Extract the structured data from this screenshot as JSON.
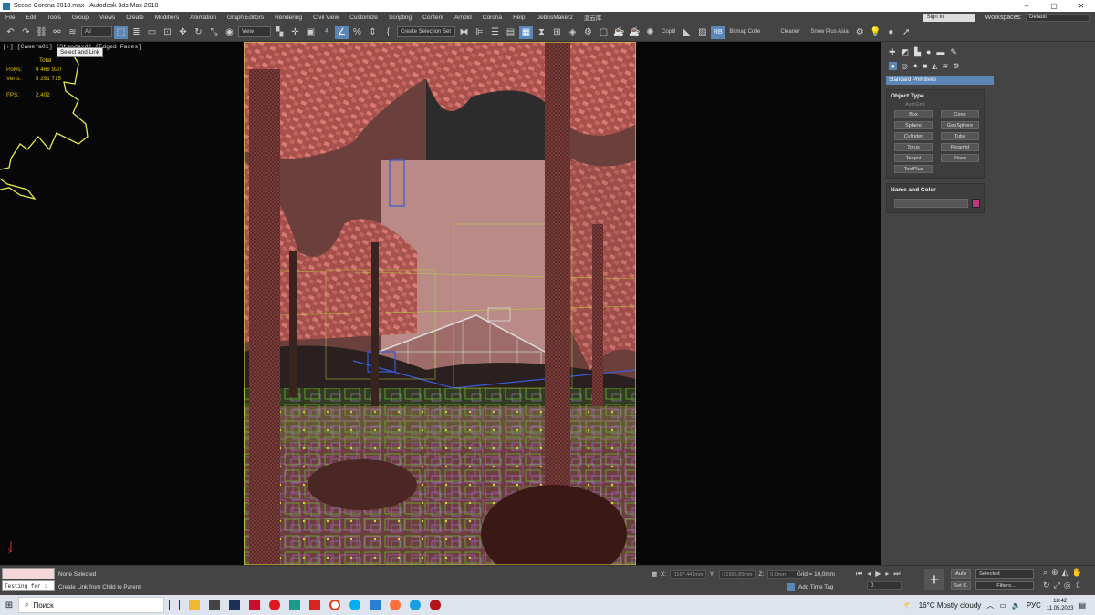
{
  "window": {
    "title": "Scene Corona 2018.max - Autodesk 3ds Max 2018",
    "minimize": "–",
    "maximize": "▢",
    "close": "✕"
  },
  "menu": {
    "items": [
      "File",
      "Edit",
      "Tools",
      "Group",
      "Views",
      "Create",
      "Modifiers",
      "Animation",
      "Graph Editors",
      "Rendering",
      "Civil View",
      "Customize",
      "Scripting",
      "Content",
      "Arnold",
      "Corona",
      "Help",
      "DebrisMaker2",
      "渲云库"
    ],
    "sign_in": "Sign In",
    "workspaces_label": "Workspaces:",
    "workspace": "Default"
  },
  "toolbar": {
    "filter": "All",
    "view": "View",
    "selection_set": "Create Selection Set",
    "copitl": "Copitl",
    "bitmap": "Bitmap Colle",
    "cleaner": "Cleaner",
    "snow": "Snow Plus Asia",
    "rb": "RB"
  },
  "tooltip": "Select and Link",
  "viewport": {
    "label": "[+] [Camera01] [Standard] [Edged Faces]",
    "stats_header": "Total",
    "polys_label": "Polys:",
    "polys": "4 466 920",
    "verts_label": "Verts:",
    "verts": "8 291 715",
    "fps_label": "FPS:",
    "fps": "2,402"
  },
  "command_panel": {
    "dropdown": "Standard Primitives",
    "object_type": "Object Type",
    "autogrid": "AutoGrid",
    "primitives": [
      "Box",
      "Cone",
      "Sphere",
      "GeoSphere",
      "Cylinder",
      "Tube",
      "Torus",
      "Pyramid",
      "Teapot",
      "Plane",
      "TextPlus"
    ],
    "name_color": "Name and Color",
    "color": "#c2377a"
  },
  "status": {
    "maxscript_input": "Testing for :",
    "selection": "None Selected",
    "prompt": "Create Link from Child to Parent",
    "x_label": "X:",
    "x": "-1167,441mm",
    "y_label": "Y:",
    "y": "-31995,85mm",
    "z_label": "Z:",
    "z": "0,0mm",
    "grid": "Grid = 10,0mm",
    "add_time_tag": "Add Time Tag",
    "frame": "0",
    "auto": "Auto",
    "set_k": "Set K.",
    "key_mode": "Selected",
    "filters": "Filters..."
  },
  "taskbar": {
    "search_placeholder": "Поиск",
    "weather": "16°C  Mostly cloudy",
    "lang": "РУС",
    "time": "18:42",
    "date": "11.05.2023"
  }
}
